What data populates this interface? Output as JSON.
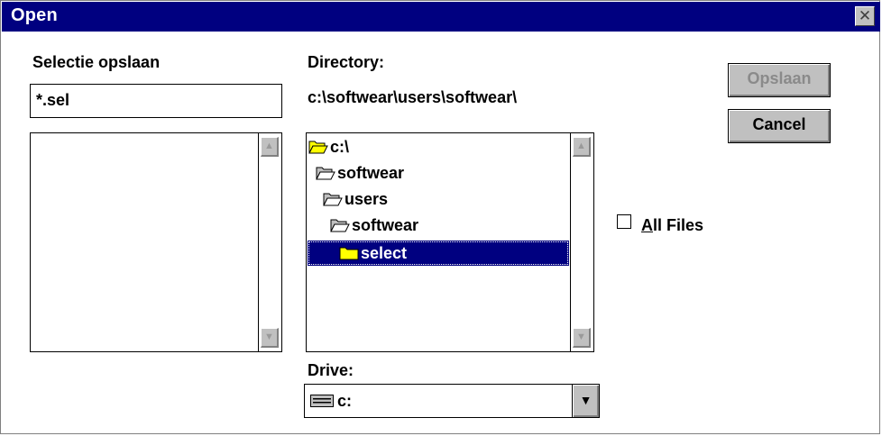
{
  "window": {
    "title": "Open",
    "close_glyph": "✕"
  },
  "file": {
    "label": "Selectie opslaan",
    "value": "*.sel",
    "list": []
  },
  "directory": {
    "label": "Directory:",
    "path": "c:\\softwear\\users\\softwear\\",
    "items": [
      {
        "name": "c:\\",
        "icon": "open-folder-icon",
        "selected": false
      },
      {
        "name": "softwear",
        "icon": "open-folder-icon",
        "selected": false
      },
      {
        "name": "users",
        "icon": "open-folder-icon",
        "selected": false
      },
      {
        "name": "softwear",
        "icon": "open-folder-icon",
        "selected": false
      },
      {
        "name": "select",
        "icon": "closed-folder-icon",
        "selected": true
      }
    ]
  },
  "drive": {
    "label": "Drive:",
    "value": "c:",
    "icon": "drive-icon"
  },
  "buttons": {
    "save": "Opslaan",
    "cancel": "Cancel"
  },
  "all_files": {
    "accel": "A",
    "rest": "ll Files",
    "checked": false
  },
  "scroll": {
    "up_glyph": "▲",
    "down_glyph": "▼",
    "drop_glyph": "▼"
  },
  "colors": {
    "titlebar": "#000080",
    "selection": "#000080",
    "face": "#c0c0c0",
    "folder": "#ffff00"
  }
}
